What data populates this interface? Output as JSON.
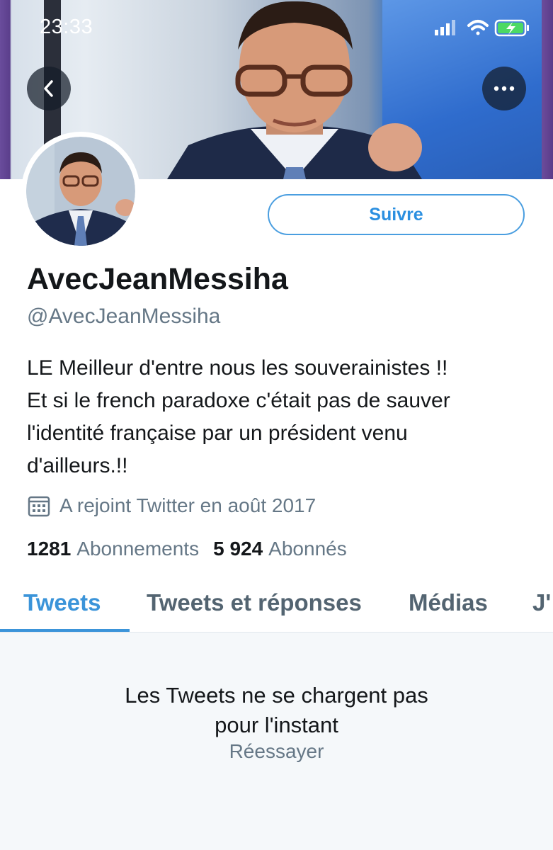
{
  "status_bar": {
    "time": "23:33",
    "signal_icon": "signal-bars-icon",
    "wifi_icon": "wifi-icon",
    "battery_icon": "battery-charging-icon"
  },
  "header": {
    "back_icon": "chevron-left-icon",
    "more_icon": "more-horizontal-icon"
  },
  "profile": {
    "display_name": "AvecJeanMessiha",
    "handle": "@AvecJeanMessiha",
    "bio_lines": [
      "LE Meilleur d'entre nous les souverainistes !!",
      "Et si le french paradoxe c'était pas de sauver",
      "l'identité française par un président venu",
      "d'ailleurs.!!"
    ],
    "joined": "A rejoint Twitter en août 2017",
    "joined_icon": "calendar-icon",
    "following_count": "1281",
    "following_label": "Abonnements",
    "followers_count": "5 924",
    "followers_label": "Abonnés",
    "follow_button": "Suivre"
  },
  "tabs": [
    {
      "label": "Tweets",
      "active": true
    },
    {
      "label": "Tweets et réponses",
      "active": false
    },
    {
      "label": "Médias",
      "active": false
    },
    {
      "label": "J'",
      "active": false
    }
  ],
  "empty_state": {
    "title_lines": [
      "Les Tweets ne se chargent pas",
      "pour l'instant"
    ],
    "retry": "Réessayer"
  },
  "colors": {
    "accent": "#3b94d9",
    "secondary_text": "#657786",
    "primary_text": "#14171a",
    "empty_bg": "#f5f8fa"
  }
}
